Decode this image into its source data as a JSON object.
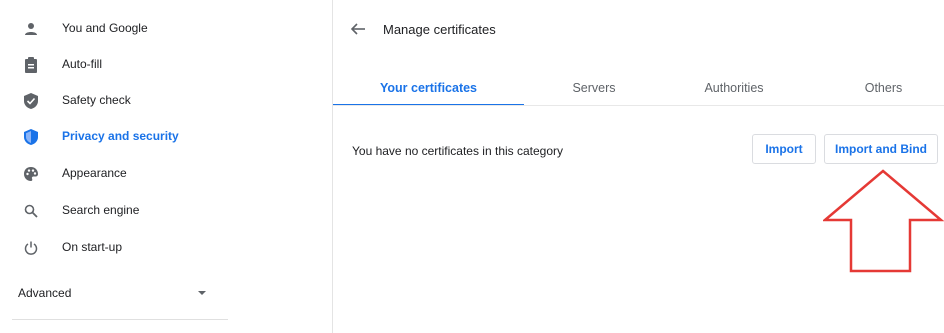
{
  "sidebar": {
    "items": [
      {
        "label": "You and Google",
        "icon": "person-icon"
      },
      {
        "label": "Auto-fill",
        "icon": "clipboard-icon"
      },
      {
        "label": "Safety check",
        "icon": "shield-check-icon"
      },
      {
        "label": "Privacy and security",
        "icon": "shield-icon",
        "active": true
      },
      {
        "label": "Appearance",
        "icon": "palette-icon"
      },
      {
        "label": "Search engine",
        "icon": "search-icon"
      },
      {
        "label": "On start-up",
        "icon": "power-icon"
      }
    ],
    "advanced_label": "Advanced"
  },
  "main": {
    "title": "Manage certificates",
    "tabs": [
      {
        "label": "Your certificates",
        "active": true
      },
      {
        "label": "Servers"
      },
      {
        "label": "Authorities"
      },
      {
        "label": "Others"
      }
    ],
    "empty_message": "You have no certificates in this category",
    "import_label": "Import",
    "import_bind_label": "Import and Bind"
  },
  "colors": {
    "accent": "#1a73e8",
    "annotation_arrow": "#e53935"
  }
}
